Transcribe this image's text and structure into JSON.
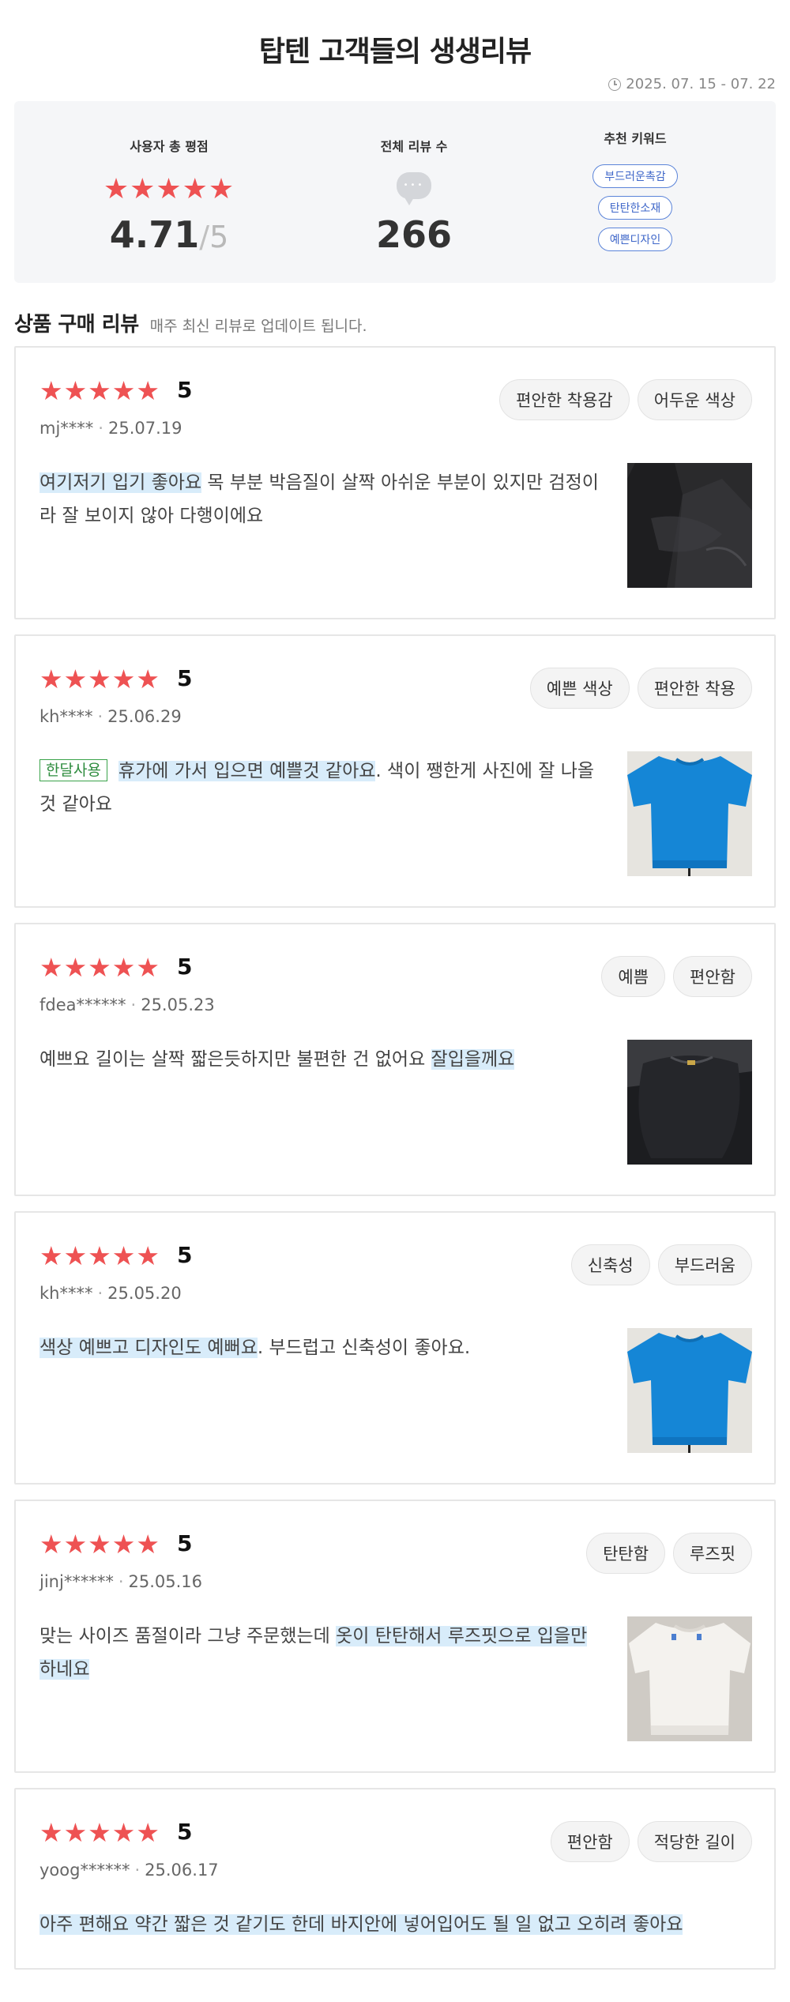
{
  "header": {
    "title": "탑텐 고객들의 생생리뷰",
    "date_range": "2025. 07. 15 - 07. 22"
  },
  "summary": {
    "rating_label": "사용자 총 평점",
    "rating_stars": "★★★★★",
    "rating_value": "4.71",
    "rating_sep": "/",
    "rating_max": "5",
    "count_label": "전체 리뷰 수",
    "count_value": "266",
    "keywords_label": "추천 키워드",
    "keywords": [
      "부드러운촉감",
      "탄탄한소재",
      "예쁜디자인"
    ]
  },
  "section": {
    "title": "상품 구매 리뷰",
    "subtitle": "매주 최신 리뷰로 업데이트 됩니다."
  },
  "reviews": [
    {
      "stars": "★★★★★",
      "score": "5",
      "user": "mj****",
      "date": "25.07.19",
      "tags": [
        "편안한 착용감",
        "어두운 색상"
      ],
      "highlight": "여기저기 입기 좋아요",
      "text": " 목 부분 박음질이 살짝 아쉬운 부분이 있지만 검정이라 잘 보이지 않아 다행이에요",
      "photo": "dark-knit-photo"
    },
    {
      "stars": "★★★★★",
      "score": "5",
      "user": "kh****",
      "date": "25.06.29",
      "tags": [
        "예쁜 색상",
        "편안한 착용"
      ],
      "badge": "한달사용",
      "highlight": "휴가에 가서 입으면 예쁠것 같아요",
      "text": ". 색이 쨍한게 사진에 잘 나올 것 같아요",
      "photo": "blue-tshirt-photo"
    },
    {
      "stars": "★★★★★",
      "score": "5",
      "user": "fdea******",
      "date": "25.05.23",
      "tags": [
        "예쁨",
        "편안함"
      ],
      "text_before": "예쁘요 길이는 살짝 짧은듯하지만 불편한 건 없어요 ",
      "highlight": "잘입을께요",
      "photo": "black-knit-photo"
    },
    {
      "stars": "★★★★★",
      "score": "5",
      "user": "kh****",
      "date": "25.05.20",
      "tags": [
        "신축성",
        "부드러움"
      ],
      "highlight": "색상 예쁘고 디자인도 예뻐요",
      "text": ". 부드럽고 신축성이 좋아요.",
      "photo": "blue-tshirt-photo"
    },
    {
      "stars": "★★★★★",
      "score": "5",
      "user": "jinj******",
      "date": "25.05.16",
      "tags": [
        "탄탄함",
        "루즈핏"
      ],
      "text_before": "맞는 사이즈 품절이라 그냥 주문했는데 ",
      "highlight": "옷이 탄탄해서 루즈핏으로 입을만하네요",
      "photo": "white-knit-photo"
    },
    {
      "stars": "★★★★★",
      "score": "5",
      "user": "yoog******",
      "date": "25.06.17",
      "tags": [
        "편안함",
        "적당한 길이"
      ],
      "highlight": "아주 편해요 약간 짧은 것 같기도 한데 바지안에 넣어입어도 될 일 없고 오히려 좋아요"
    }
  ],
  "colors": {
    "star": "#ee5253",
    "keyword_border": "#5b84d9",
    "highlight": "#d8ecfa",
    "badge_green": "#3aa34a",
    "summary_bg": "#f5f6f8"
  }
}
